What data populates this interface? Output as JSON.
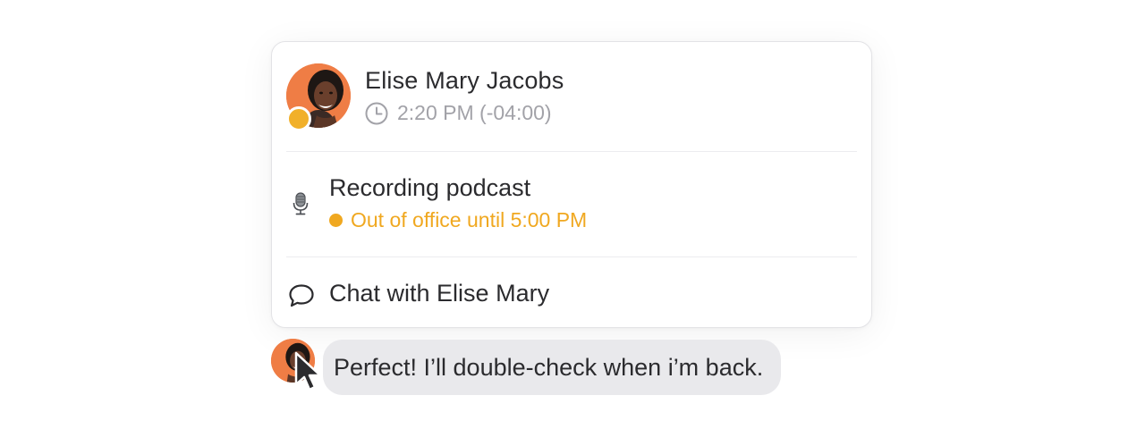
{
  "profile": {
    "name": "Elise Mary Jacobs",
    "local_time": "2:20 PM (-04:00)",
    "presence_color": "#f1b02a",
    "avatar_bg": "#ef7d45"
  },
  "status": {
    "emoji_icon": "microphone-icon",
    "title": "Recording podcast",
    "availability": "Out of office until 5:00 PM",
    "availability_color": "#f0a820"
  },
  "actions": {
    "chat_label": "Chat with Elise Mary",
    "chat_icon": "speech-bubble-icon"
  },
  "message": {
    "text": "Perfect! I’ll double-check when i’m back.",
    "bubble_color": "#e9e9ec"
  }
}
